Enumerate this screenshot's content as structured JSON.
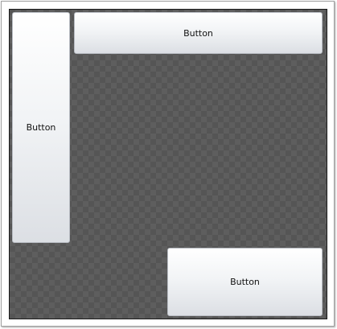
{
  "buttons": {
    "left_label": "Button",
    "top_label": "Button",
    "bottom_label": "Button"
  }
}
